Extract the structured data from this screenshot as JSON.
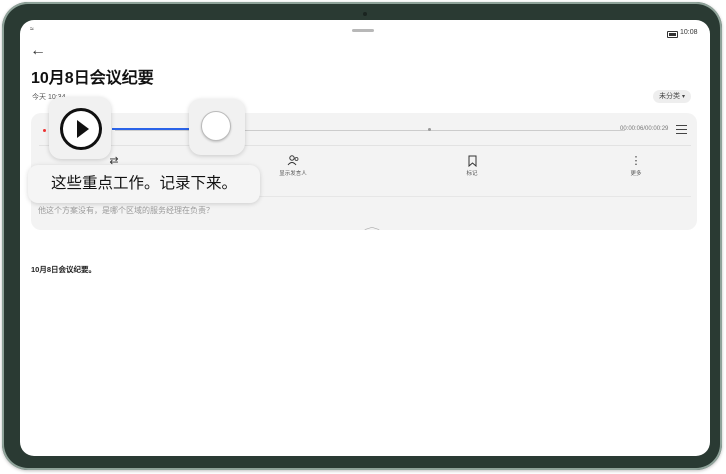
{
  "statusbar": {
    "time": "10:08",
    "wifi_icon": "wifi-icon",
    "battery_icon": "battery-icon"
  },
  "header": {
    "back_icon": "back-arrow-icon",
    "title": "10月8日会议纪要",
    "subtitle": "今天 10:34",
    "category_label": "未分类"
  },
  "recorder": {
    "time_text": "00:00:06/00:00:29",
    "progress": 0.2,
    "tools": [
      {
        "label": "",
        "icon": "convert-icon"
      },
      {
        "label": "显示发言人",
        "icon": "speaker-icon"
      },
      {
        "label": "标记",
        "icon": "bookmark-icon"
      },
      {
        "label": "更多",
        "icon": "more-icon"
      }
    ],
    "transcript": "他这个方案没有，是哪个区域的服务经理在负责？"
  },
  "note_body": "10月8日会议纪要。",
  "overlay": {
    "caption": "这些重点工作。记录下来。",
    "play_icon": "play-icon"
  },
  "colors": {
    "accent": "#2a63e8",
    "record": "#e33333"
  }
}
